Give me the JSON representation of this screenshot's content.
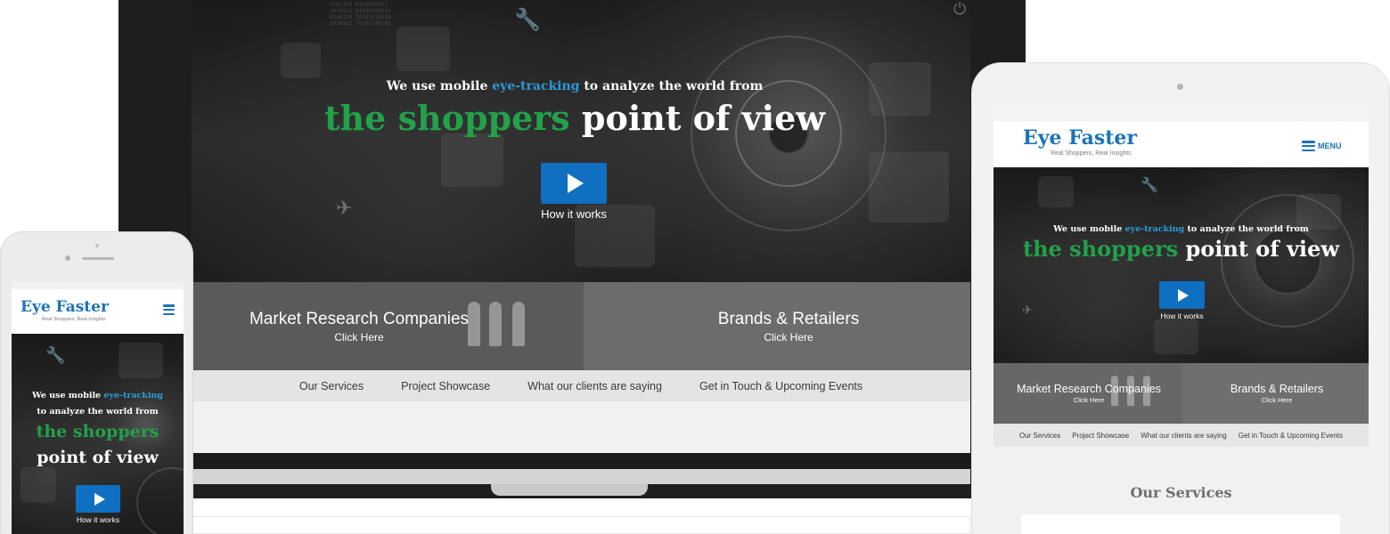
{
  "brand": {
    "name": "Eye Faster",
    "tagline": "Real Shoppers, Real Insights",
    "accent_blue": "#0f6fc0",
    "accent_green": "#22a14a",
    "highlight_blue": "#2a9ad8"
  },
  "hero": {
    "intro_prefix": "We use mobile ",
    "intro_highlight": "eye-tracking",
    "intro_suffix": " to analyze the world from",
    "phone_intro_line1_prefix": "We use mobile ",
    "phone_intro_line2": "to analyze the world from",
    "headline_green": "the shoppers",
    "headline_white": "point of view",
    "cta_label": "How it works",
    "play_icon": "play-icon"
  },
  "segments": [
    {
      "title": "Market Research Companies",
      "subtitle": "Click Here"
    },
    {
      "title": "Brands & Retailers",
      "subtitle": "Click Here"
    }
  ],
  "nav": {
    "items": [
      "Our Services",
      "Project Showcase",
      "What our clients are saying",
      "Get in Touch & Upcoming Events"
    ]
  },
  "tablet": {
    "menu_label": "MENU",
    "section_title": "Our Services"
  }
}
